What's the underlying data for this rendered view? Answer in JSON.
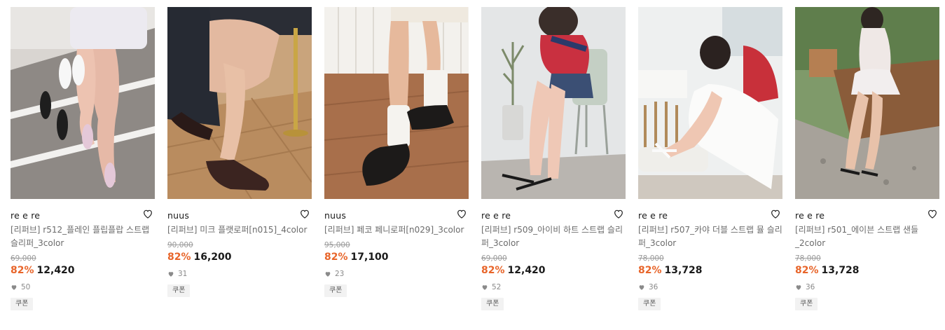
{
  "products": [
    {
      "brand": "re e re",
      "title": "[리퍼브] r512_플레인 플립플랍 스트랩 슬리퍼_3color",
      "original_price": "69,000",
      "discount": "82%",
      "price": "12,420",
      "likes": "50",
      "coupon": "쿠폰"
    },
    {
      "brand": "nuus",
      "title": "[리퍼브] 미크 플랫로퍼[n015]_4color",
      "original_price": "90,000",
      "discount": "82%",
      "price": "16,200",
      "likes": "31",
      "coupon": "쿠폰"
    },
    {
      "brand": "nuus",
      "title": "[리퍼브] 페코 페니로퍼[n029]_3color",
      "original_price": "95,000",
      "discount": "82%",
      "price": "17,100",
      "likes": "23",
      "coupon": "쿠폰"
    },
    {
      "brand": "re e re",
      "title": "[리퍼브] r509_아이비 하트 스트랩 슬리퍼_3color",
      "original_price": "69,000",
      "discount": "82%",
      "price": "12,420",
      "likes": "52",
      "coupon": "쿠폰"
    },
    {
      "brand": "re e re",
      "title": "[리퍼브] r507_카야 더블 스트랩 뮬 슬리퍼_3color",
      "original_price": "78,000",
      "discount": "82%",
      "price": "13,728",
      "likes": "36",
      "coupon": "쿠폰"
    },
    {
      "brand": "re e re",
      "title": "[리퍼브] r501_에이븐 스트랩 샌들 _2color",
      "original_price": "78,000",
      "discount": "82%",
      "price": "13,728",
      "likes": "36",
      "coupon": "쿠폰"
    }
  ],
  "colors": {
    "discount": "#e8652a",
    "title": "#6b6b6b",
    "badge_bg": "#f2f2f2"
  },
  "icons": {
    "wishlist": "heart-outline-icon",
    "likes": "heart-filled-icon"
  }
}
